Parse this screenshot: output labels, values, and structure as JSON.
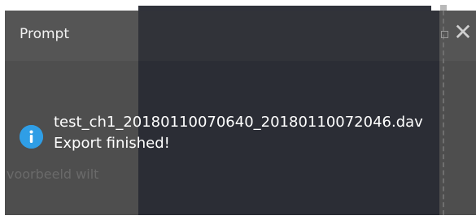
{
  "dialog": {
    "title": "Prompt",
    "close_glyph": "✕",
    "minimize_glyph": "",
    "background_text": "voorbeeld wilt",
    "message": {
      "filename": "test_ch1_20180110070640_20180110072046.dav",
      "status": "Export finished!"
    },
    "icons": {
      "info": "info-icon",
      "close": "close-icon",
      "minimize": "minimize-icon"
    },
    "colors": {
      "titlebar": "#555555",
      "body": "#4e4e4e",
      "overlay": "#22252e",
      "info_icon": "#2f9ee6",
      "text": "#ffffff"
    }
  }
}
